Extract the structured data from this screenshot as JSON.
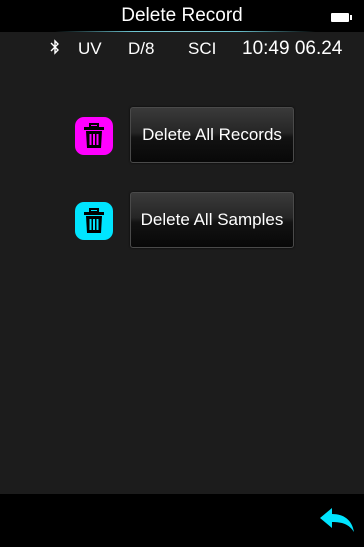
{
  "header": {
    "title": "Delete Record",
    "battery_icon": "battery-icon"
  },
  "status": {
    "bluetooth_icon": "bluetooth-icon",
    "bluetooth_glyph": "∦",
    "light_source": "UV",
    "geometry": "D/8",
    "mode": "SCI",
    "datetime": "10:49 06.24"
  },
  "actions": [
    {
      "label": "Delete All Records",
      "icon": "trash-icon",
      "icon_color": "#ff00ff"
    },
    {
      "label": "Delete All Samples",
      "icon": "trash-icon",
      "icon_color": "#00e5ff"
    }
  ],
  "footer": {
    "back_icon": "back-arrow-icon",
    "back_color": "#00e5ff"
  }
}
